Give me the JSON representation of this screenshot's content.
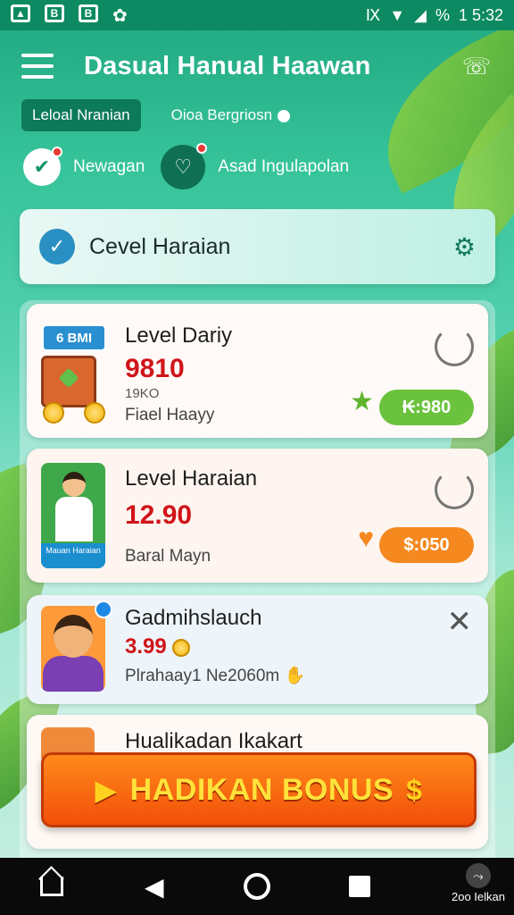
{
  "status_bar": {
    "time": "1 5:32",
    "battery": "%",
    "left_icons": [
      "image-icon",
      "b-icon",
      "b-icon",
      "clover-icon"
    ]
  },
  "header": {
    "title": "Dasual Hanual Haawan"
  },
  "tabs": [
    {
      "label": "Leloal Nranian",
      "active": true
    },
    {
      "label": "Oioa Bergriosn",
      "active": false
    }
  ],
  "quick_actions": [
    {
      "label": "Newagan"
    },
    {
      "label": "Asad Ingulapolan"
    }
  ],
  "section": {
    "title": "Cevel Haraian"
  },
  "cards": [
    {
      "badge": "6 BMI",
      "title": "Level Dariy",
      "amount": "9810",
      "sub": "19KO",
      "footer": "Fiael Haayy",
      "pill": "₭:980"
    },
    {
      "thumb_caption": "Mauan Haraian",
      "title": "Level Haraian",
      "amount": "12.90",
      "footer": "Baral Mayn",
      "pill": "$:050"
    },
    {
      "title": "Gadmihslauch",
      "amount": "3.99",
      "footer": "Plrahaay1 Ne2060m"
    },
    {
      "title": "Hualikadan Ikakart"
    }
  ],
  "bonus": {
    "label": "HADIKAN BONUS"
  },
  "nav": {
    "right_label": "2oo Ielkan"
  },
  "colors": {
    "primary": "#0d8a62",
    "accent_green": "#6bc33d",
    "accent_orange": "#f5891f",
    "amount_red": "#d0141a",
    "bonus_yellow": "#ffe23a"
  }
}
